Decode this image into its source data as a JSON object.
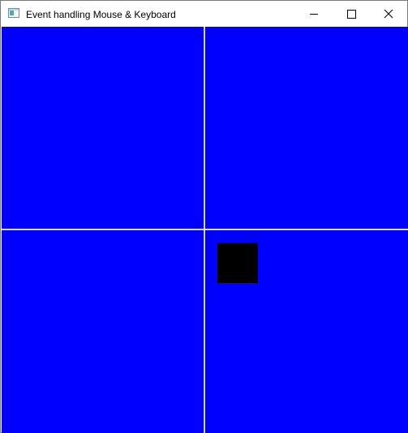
{
  "window": {
    "title": "Event handling Mouse & Keyboard",
    "controls": {
      "minimize_icon": "minimize-icon",
      "maximize_icon": "maximize-icon",
      "close_icon": "close-icon"
    }
  },
  "canvas": {
    "background_color": "#0000ff",
    "divider_color": "#d8d8ff",
    "quadrants": [
      "top-left",
      "top-right",
      "bottom-left",
      "bottom-right"
    ],
    "player_square": {
      "color": "#000000",
      "quadrant": "bottom-right"
    }
  }
}
